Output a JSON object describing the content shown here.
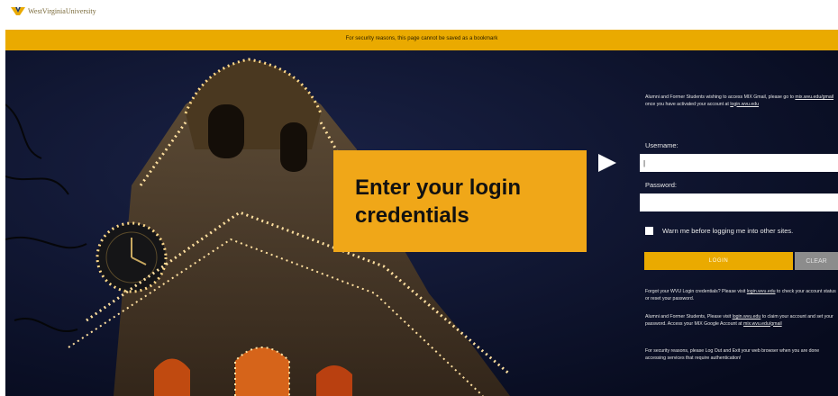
{
  "header": {
    "logo_text": "WestVirginiaUniversity",
    "logo_icon": "flying-wv-icon"
  },
  "banner": {
    "text": "For security reasons, this page cannot be saved as a bookmark"
  },
  "callout": {
    "line1": "Enter your login",
    "line2": "credentials",
    "pointer_icon": "triangle-right-icon"
  },
  "login": {
    "alumni_notice": {
      "text1": "Alumni and Former Students wishing to access MIX Gmail, please go to ",
      "link1": "mix.wvu.edu/gmail",
      "text2": " once you have activated your account at ",
      "link2": "login.wvu.edu"
    },
    "username_label": "Username:",
    "username_value": "|",
    "password_label": "Password:",
    "password_value": "",
    "warn_label": "Warn me before logging me into other sites.",
    "login_button": "LOGIN",
    "clear_button": "CLEAR",
    "forgot": {
      "text1": "Forgot your WVU Login credentials? Please visit ",
      "link": "login.wvu.edu",
      "text2": " to check your account status or reset your password."
    },
    "alumni_claim": {
      "text1": "Alumni and Former Students, Please visit ",
      "link1": "login.wvu.edu",
      "text2": " to claim your account and set your password. Access your MIX Google Account at ",
      "link2": "mix.wvu.edu/gmail"
    },
    "security_note": "For security reasons, please Log Out and Exit your web browser when you are done accessing services that require authentication!"
  },
  "colors": {
    "gold": "#eaaa00",
    "callout": "#f0a718",
    "night_sky": "#0a1026",
    "clear_button": "#8c8c8c"
  }
}
